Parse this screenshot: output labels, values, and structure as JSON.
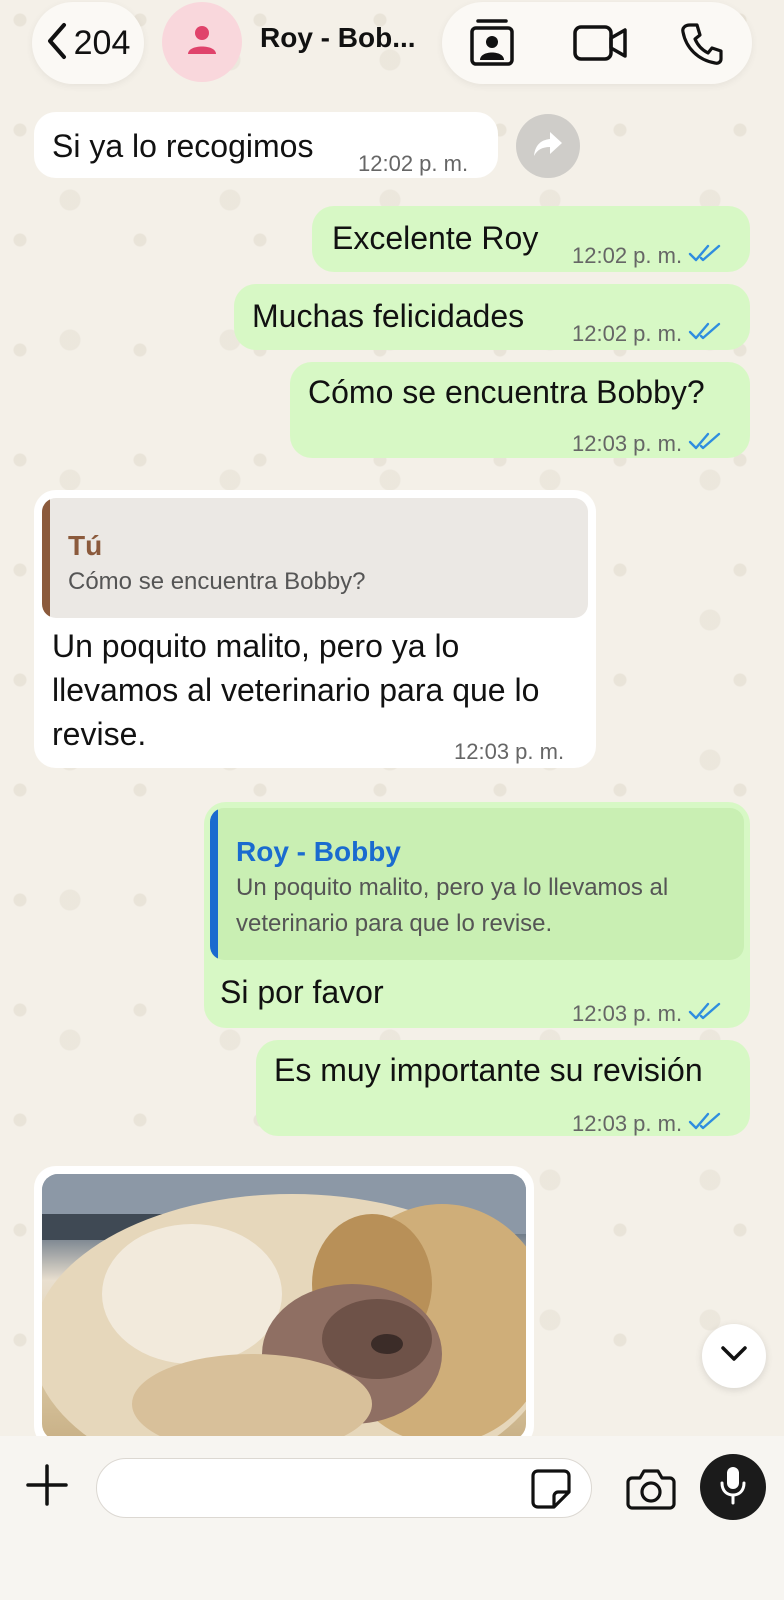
{
  "header": {
    "back_count": "204",
    "contact_name": "Roy - Bob..."
  },
  "messages": [
    {
      "text": "Si ya lo recogimos",
      "time": "12:02 p. m."
    },
    {
      "text": "Excelente Roy",
      "time": "12:02 p. m."
    },
    {
      "text": "Muchas felicidades",
      "time": "12:02 p. m."
    },
    {
      "text": "Cómo se encuentra Bobby?",
      "time": "12:03 p. m."
    },
    {
      "quote_name": "Tú",
      "quote_text": "Cómo se encuentra Bobby?",
      "text_lines": [
        "Un poquito malito, pero ya lo",
        "llevamos al veterinario para que lo",
        "revise."
      ],
      "time": "12:03 p. m."
    },
    {
      "quote_name": "Roy - Bobby",
      "quote_lines": [
        "Un poquito malito, pero ya lo llevamos al",
        "veterinario para que lo revise."
      ],
      "text": "Si por favor",
      "time": "12:03 p. m."
    },
    {
      "text": "Es muy importante su revisión",
      "time": "12:03 p. m."
    }
  ],
  "colors": {
    "outgoing_bubble": "#d7f8c5",
    "incoming_bubble": "#ffffff",
    "read_ticks": "#2f8ddf",
    "quote_self_bar": "#8b5a3c",
    "quote_contact_bar": "#1a6bcf",
    "quote_contact_name": "#1a6bcf",
    "quote_self_name": "#8b5a3c"
  },
  "icons": {
    "back": "chevron-left-icon",
    "avatar": "person-icon",
    "contact_card": "contact-card-icon",
    "video": "video-camera-icon",
    "phone": "phone-icon",
    "forward": "forward-arrow-icon",
    "scroll": "chevron-down-icon",
    "plus": "plus-icon",
    "sticker": "sticker-icon",
    "camera": "camera-icon",
    "mic": "microphone-icon"
  }
}
